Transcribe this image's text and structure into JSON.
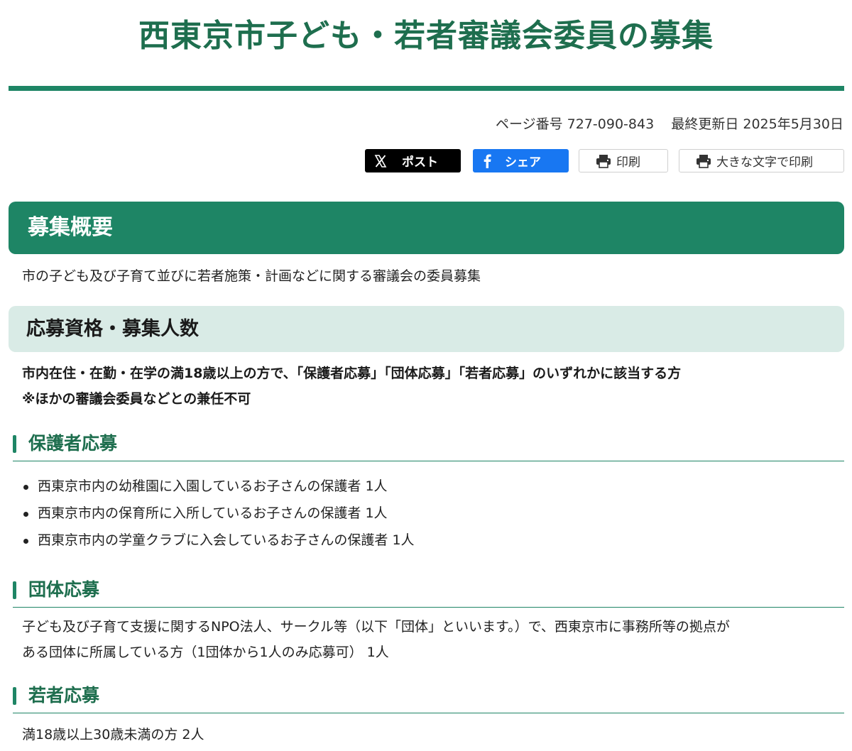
{
  "page": {
    "title": "西東京市子ども・若者審議会委員の募集",
    "page_number_label": "ページ番号 727-090-843",
    "updated_label": "最終更新日 2025年5月30日"
  },
  "share": {
    "x_label": "ポスト",
    "facebook_label": "シェア",
    "print_label": "印刷",
    "large_print_label": "大きな文字で印刷"
  },
  "overview": {
    "heading": "募集概要",
    "text": "市の子ども及び子育て並びに若者施策・計画などに関する審議会の委員募集"
  },
  "qualification": {
    "heading": "応募資格・募集人数",
    "line1": "市内在住・在勤・在学の満18歳以上の方で、「保護者応募」「団体応募」「若者応募」のいずれかに該当する方",
    "line2": "※ほかの審議会委員などとの兼任不可"
  },
  "guardian": {
    "heading": "保護者応募",
    "items": [
      "西東京市内の幼稚園に入園しているお子さんの保護者 1人",
      "西東京市内の保育所に入所しているお子さんの保護者 1人",
      "西東京市内の学童クラブに入会しているお子さんの保護者 1人"
    ]
  },
  "group": {
    "heading": "団体応募",
    "line1": "子ども及び子育て支援に関するNPO法人、サークル等（以下「団体」といいます。）で、西東京市に事務所等の拠点が",
    "line2": "ある団体に所属している方（1団体から1人のみ応募可） 1人"
  },
  "youth": {
    "heading": "若者応募",
    "text": "満18歳以上30歳未満の方 2人"
  },
  "colors": {
    "accent": "#1e8565",
    "heading_text": "#1e6e4e",
    "sub_heading_bg": "#d9ebe6",
    "x_button": "#000000",
    "facebook_button": "#1877f2"
  }
}
